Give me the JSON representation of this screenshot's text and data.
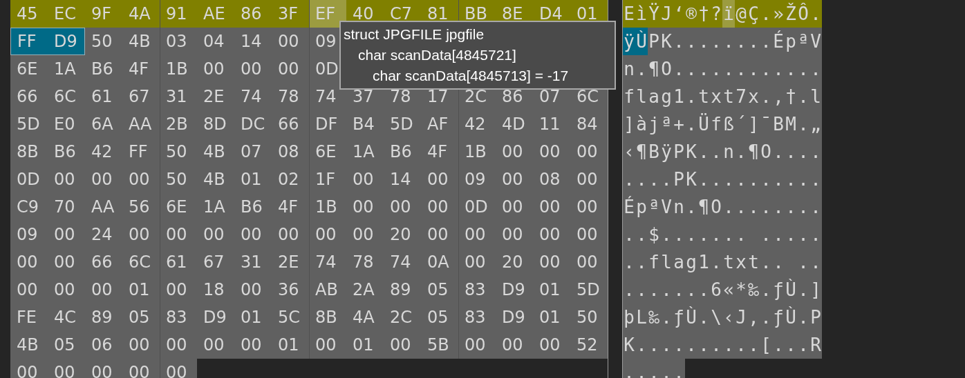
{
  "hex_rows": [
    {
      "highlighted": true,
      "bytes": [
        {
          "hex": "45",
          "selected": false,
          "hovered": false
        },
        {
          "hex": "EC",
          "selected": false,
          "hovered": false
        },
        {
          "hex": "9F",
          "selected": false,
          "hovered": false
        },
        {
          "hex": "4A",
          "selected": false,
          "hovered": false
        },
        {
          "hex": "91",
          "selected": false,
          "hovered": false
        },
        {
          "hex": "AE",
          "selected": false,
          "hovered": false
        },
        {
          "hex": "86",
          "selected": false,
          "hovered": false
        },
        {
          "hex": "3F",
          "selected": false,
          "hovered": false
        },
        {
          "hex": "EF",
          "selected": false,
          "hovered": true
        },
        {
          "hex": "40",
          "selected": false,
          "hovered": false
        },
        {
          "hex": "C7",
          "selected": false,
          "hovered": false
        },
        {
          "hex": "81",
          "selected": false,
          "hovered": false
        },
        {
          "hex": "BB",
          "selected": false,
          "hovered": false
        },
        {
          "hex": "8E",
          "selected": false,
          "hovered": false
        },
        {
          "hex": "D4",
          "selected": false,
          "hovered": false
        },
        {
          "hex": "01",
          "selected": false,
          "hovered": false
        }
      ],
      "text": "EìŸJ‘®†?ï@Ç.»ŽÔ."
    },
    {
      "highlighted": false,
      "bytes": [
        {
          "hex": "FF",
          "selected": true,
          "hovered": false
        },
        {
          "hex": "D9",
          "selected": true,
          "hovered": false
        },
        {
          "hex": "50",
          "selected": false,
          "hovered": false
        },
        {
          "hex": "4B",
          "selected": false,
          "hovered": false
        },
        {
          "hex": "03",
          "selected": false,
          "hovered": false
        },
        {
          "hex": "04",
          "selected": false,
          "hovered": false
        },
        {
          "hex": "14",
          "selected": false,
          "hovered": false
        },
        {
          "hex": "00",
          "selected": false,
          "hovered": false
        },
        {
          "hex": "09",
          "selected": false,
          "hovered": false
        }
      ],
      "text": "ÿÙPK........ÉpªV"
    },
    {
      "highlighted": false,
      "bytes": [
        {
          "hex": "6E",
          "selected": false,
          "hovered": false
        },
        {
          "hex": "1A",
          "selected": false,
          "hovered": false
        },
        {
          "hex": "B6",
          "selected": false,
          "hovered": false
        },
        {
          "hex": "4F",
          "selected": false,
          "hovered": false
        },
        {
          "hex": "1B",
          "selected": false,
          "hovered": false
        },
        {
          "hex": "00",
          "selected": false,
          "hovered": false
        },
        {
          "hex": "00",
          "selected": false,
          "hovered": false
        },
        {
          "hex": "00",
          "selected": false,
          "hovered": false
        },
        {
          "hex": "0D",
          "selected": false,
          "hovered": false
        }
      ],
      "text": "n.¶O............"
    },
    {
      "highlighted": false,
      "bytes": [
        {
          "hex": "66",
          "selected": false,
          "hovered": false
        },
        {
          "hex": "6C",
          "selected": false,
          "hovered": false
        },
        {
          "hex": "61",
          "selected": false,
          "hovered": false
        },
        {
          "hex": "67",
          "selected": false,
          "hovered": false
        },
        {
          "hex": "31",
          "selected": false,
          "hovered": false
        },
        {
          "hex": "2E",
          "selected": false,
          "hovered": false
        },
        {
          "hex": "74",
          "selected": false,
          "hovered": false
        },
        {
          "hex": "78",
          "selected": false,
          "hovered": false
        },
        {
          "hex": "74",
          "selected": false,
          "hovered": false
        },
        {
          "hex": "37",
          "selected": false,
          "hovered": false
        },
        {
          "hex": "78",
          "selected": false,
          "hovered": false
        },
        {
          "hex": "17",
          "selected": false,
          "hovered": false
        },
        {
          "hex": "2C",
          "selected": false,
          "hovered": false
        },
        {
          "hex": "86",
          "selected": false,
          "hovered": false
        },
        {
          "hex": "07",
          "selected": false,
          "hovered": false
        },
        {
          "hex": "6C",
          "selected": false,
          "hovered": false
        }
      ],
      "text": "flag1.txt7x.,†.l"
    },
    {
      "highlighted": false,
      "bytes": [
        {
          "hex": "5D",
          "selected": false,
          "hovered": false
        },
        {
          "hex": "E0",
          "selected": false,
          "hovered": false
        },
        {
          "hex": "6A",
          "selected": false,
          "hovered": false
        },
        {
          "hex": "AA",
          "selected": false,
          "hovered": false
        },
        {
          "hex": "2B",
          "selected": false,
          "hovered": false
        },
        {
          "hex": "8D",
          "selected": false,
          "hovered": false
        },
        {
          "hex": "DC",
          "selected": false,
          "hovered": false
        },
        {
          "hex": "66",
          "selected": false,
          "hovered": false
        },
        {
          "hex": "DF",
          "selected": false,
          "hovered": false
        },
        {
          "hex": "B4",
          "selected": false,
          "hovered": false
        },
        {
          "hex": "5D",
          "selected": false,
          "hovered": false
        },
        {
          "hex": "AF",
          "selected": false,
          "hovered": false
        },
        {
          "hex": "42",
          "selected": false,
          "hovered": false
        },
        {
          "hex": "4D",
          "selected": false,
          "hovered": false
        },
        {
          "hex": "11",
          "selected": false,
          "hovered": false
        },
        {
          "hex": "84",
          "selected": false,
          "hovered": false
        }
      ],
      "text": "]àjª+.Üfß´]¯BM.„"
    },
    {
      "highlighted": false,
      "bytes": [
        {
          "hex": "8B",
          "selected": false,
          "hovered": false
        },
        {
          "hex": "B6",
          "selected": false,
          "hovered": false
        },
        {
          "hex": "42",
          "selected": false,
          "hovered": false
        },
        {
          "hex": "FF",
          "selected": false,
          "hovered": false
        },
        {
          "hex": "50",
          "selected": false,
          "hovered": false
        },
        {
          "hex": "4B",
          "selected": false,
          "hovered": false
        },
        {
          "hex": "07",
          "selected": false,
          "hovered": false
        },
        {
          "hex": "08",
          "selected": false,
          "hovered": false
        },
        {
          "hex": "6E",
          "selected": false,
          "hovered": false
        },
        {
          "hex": "1A",
          "selected": false,
          "hovered": false
        },
        {
          "hex": "B6",
          "selected": false,
          "hovered": false
        },
        {
          "hex": "4F",
          "selected": false,
          "hovered": false
        },
        {
          "hex": "1B",
          "selected": false,
          "hovered": false
        },
        {
          "hex": "00",
          "selected": false,
          "hovered": false
        },
        {
          "hex": "00",
          "selected": false,
          "hovered": false
        },
        {
          "hex": "00",
          "selected": false,
          "hovered": false
        }
      ],
      "text": "‹¶BÿPK..n.¶O...."
    },
    {
      "highlighted": false,
      "bytes": [
        {
          "hex": "0D",
          "selected": false,
          "hovered": false
        },
        {
          "hex": "00",
          "selected": false,
          "hovered": false
        },
        {
          "hex": "00",
          "selected": false,
          "hovered": false
        },
        {
          "hex": "00",
          "selected": false,
          "hovered": false
        },
        {
          "hex": "50",
          "selected": false,
          "hovered": false
        },
        {
          "hex": "4B",
          "selected": false,
          "hovered": false
        },
        {
          "hex": "01",
          "selected": false,
          "hovered": false
        },
        {
          "hex": "02",
          "selected": false,
          "hovered": false
        },
        {
          "hex": "1F",
          "selected": false,
          "hovered": false
        },
        {
          "hex": "00",
          "selected": false,
          "hovered": false
        },
        {
          "hex": "14",
          "selected": false,
          "hovered": false
        },
        {
          "hex": "00",
          "selected": false,
          "hovered": false
        },
        {
          "hex": "09",
          "selected": false,
          "hovered": false
        },
        {
          "hex": "00",
          "selected": false,
          "hovered": false
        },
        {
          "hex": "08",
          "selected": false,
          "hovered": false
        },
        {
          "hex": "00",
          "selected": false,
          "hovered": false
        }
      ],
      "text": "....PK.........."
    },
    {
      "highlighted": false,
      "bytes": [
        {
          "hex": "C9",
          "selected": false,
          "hovered": false
        },
        {
          "hex": "70",
          "selected": false,
          "hovered": false
        },
        {
          "hex": "AA",
          "selected": false,
          "hovered": false
        },
        {
          "hex": "56",
          "selected": false,
          "hovered": false
        },
        {
          "hex": "6E",
          "selected": false,
          "hovered": false
        },
        {
          "hex": "1A",
          "selected": false,
          "hovered": false
        },
        {
          "hex": "B6",
          "selected": false,
          "hovered": false
        },
        {
          "hex": "4F",
          "selected": false,
          "hovered": false
        },
        {
          "hex": "1B",
          "selected": false,
          "hovered": false
        },
        {
          "hex": "00",
          "selected": false,
          "hovered": false
        },
        {
          "hex": "00",
          "selected": false,
          "hovered": false
        },
        {
          "hex": "00",
          "selected": false,
          "hovered": false
        },
        {
          "hex": "0D",
          "selected": false,
          "hovered": false
        },
        {
          "hex": "00",
          "selected": false,
          "hovered": false
        },
        {
          "hex": "00",
          "selected": false,
          "hovered": false
        },
        {
          "hex": "00",
          "selected": false,
          "hovered": false
        }
      ],
      "text": "ÉpªVn.¶O........"
    },
    {
      "highlighted": false,
      "bytes": [
        {
          "hex": "09",
          "selected": false,
          "hovered": false
        },
        {
          "hex": "00",
          "selected": false,
          "hovered": false
        },
        {
          "hex": "24",
          "selected": false,
          "hovered": false
        },
        {
          "hex": "00",
          "selected": false,
          "hovered": false
        },
        {
          "hex": "00",
          "selected": false,
          "hovered": false
        },
        {
          "hex": "00",
          "selected": false,
          "hovered": false
        },
        {
          "hex": "00",
          "selected": false,
          "hovered": false
        },
        {
          "hex": "00",
          "selected": false,
          "hovered": false
        },
        {
          "hex": "00",
          "selected": false,
          "hovered": false
        },
        {
          "hex": "00",
          "selected": false,
          "hovered": false
        },
        {
          "hex": "20",
          "selected": false,
          "hovered": false
        },
        {
          "hex": "00",
          "selected": false,
          "hovered": false
        },
        {
          "hex": "00",
          "selected": false,
          "hovered": false
        },
        {
          "hex": "00",
          "selected": false,
          "hovered": false
        },
        {
          "hex": "00",
          "selected": false,
          "hovered": false
        },
        {
          "hex": "00",
          "selected": false,
          "hovered": false
        }
      ],
      "text": "..$....... ....."
    },
    {
      "highlighted": false,
      "bytes": [
        {
          "hex": "00",
          "selected": false,
          "hovered": false
        },
        {
          "hex": "00",
          "selected": false,
          "hovered": false
        },
        {
          "hex": "66",
          "selected": false,
          "hovered": false
        },
        {
          "hex": "6C",
          "selected": false,
          "hovered": false
        },
        {
          "hex": "61",
          "selected": false,
          "hovered": false
        },
        {
          "hex": "67",
          "selected": false,
          "hovered": false
        },
        {
          "hex": "31",
          "selected": false,
          "hovered": false
        },
        {
          "hex": "2E",
          "selected": false,
          "hovered": false
        },
        {
          "hex": "74",
          "selected": false,
          "hovered": false
        },
        {
          "hex": "78",
          "selected": false,
          "hovered": false
        },
        {
          "hex": "74",
          "selected": false,
          "hovered": false
        },
        {
          "hex": "0A",
          "selected": false,
          "hovered": false
        },
        {
          "hex": "00",
          "selected": false,
          "hovered": false
        },
        {
          "hex": "20",
          "selected": false,
          "hovered": false
        },
        {
          "hex": "00",
          "selected": false,
          "hovered": false
        },
        {
          "hex": "00",
          "selected": false,
          "hovered": false
        }
      ],
      "text": "..flag1.txt.. .."
    },
    {
      "highlighted": false,
      "bytes": [
        {
          "hex": "00",
          "selected": false,
          "hovered": false
        },
        {
          "hex": "00",
          "selected": false,
          "hovered": false
        },
        {
          "hex": "00",
          "selected": false,
          "hovered": false
        },
        {
          "hex": "01",
          "selected": false,
          "hovered": false
        },
        {
          "hex": "00",
          "selected": false,
          "hovered": false
        },
        {
          "hex": "18",
          "selected": false,
          "hovered": false
        },
        {
          "hex": "00",
          "selected": false,
          "hovered": false
        },
        {
          "hex": "36",
          "selected": false,
          "hovered": false
        },
        {
          "hex": "AB",
          "selected": false,
          "hovered": false
        },
        {
          "hex": "2A",
          "selected": false,
          "hovered": false
        },
        {
          "hex": "89",
          "selected": false,
          "hovered": false
        },
        {
          "hex": "05",
          "selected": false,
          "hovered": false
        },
        {
          "hex": "83",
          "selected": false,
          "hovered": false
        },
        {
          "hex": "D9",
          "selected": false,
          "hovered": false
        },
        {
          "hex": "01",
          "selected": false,
          "hovered": false
        },
        {
          "hex": "5D",
          "selected": false,
          "hovered": false
        }
      ],
      "text": ".......6«*‰.ƒÙ.]"
    },
    {
      "highlighted": false,
      "bytes": [
        {
          "hex": "FE",
          "selected": false,
          "hovered": false
        },
        {
          "hex": "4C",
          "selected": false,
          "hovered": false
        },
        {
          "hex": "89",
          "selected": false,
          "hovered": false
        },
        {
          "hex": "05",
          "selected": false,
          "hovered": false
        },
        {
          "hex": "83",
          "selected": false,
          "hovered": false
        },
        {
          "hex": "D9",
          "selected": false,
          "hovered": false
        },
        {
          "hex": "01",
          "selected": false,
          "hovered": false
        },
        {
          "hex": "5C",
          "selected": false,
          "hovered": false
        },
        {
          "hex": "8B",
          "selected": false,
          "hovered": false
        },
        {
          "hex": "4A",
          "selected": false,
          "hovered": false
        },
        {
          "hex": "2C",
          "selected": false,
          "hovered": false
        },
        {
          "hex": "05",
          "selected": false,
          "hovered": false
        },
        {
          "hex": "83",
          "selected": false,
          "hovered": false
        },
        {
          "hex": "D9",
          "selected": false,
          "hovered": false
        },
        {
          "hex": "01",
          "selected": false,
          "hovered": false
        },
        {
          "hex": "50",
          "selected": false,
          "hovered": false
        }
      ],
      "text": "þL‰.ƒÙ.\\‹J,.ƒÙ.P"
    },
    {
      "highlighted": false,
      "bytes": [
        {
          "hex": "4B",
          "selected": false,
          "hovered": false
        },
        {
          "hex": "05",
          "selected": false,
          "hovered": false
        },
        {
          "hex": "06",
          "selected": false,
          "hovered": false
        },
        {
          "hex": "00",
          "selected": false,
          "hovered": false
        },
        {
          "hex": "00",
          "selected": false,
          "hovered": false
        },
        {
          "hex": "00",
          "selected": false,
          "hovered": false
        },
        {
          "hex": "00",
          "selected": false,
          "hovered": false
        },
        {
          "hex": "01",
          "selected": false,
          "hovered": false
        },
        {
          "hex": "00",
          "selected": false,
          "hovered": false
        },
        {
          "hex": "01",
          "selected": false,
          "hovered": false
        },
        {
          "hex": "00",
          "selected": false,
          "hovered": false
        },
        {
          "hex": "5B",
          "selected": false,
          "hovered": false
        },
        {
          "hex": "00",
          "selected": false,
          "hovered": false
        },
        {
          "hex": "00",
          "selected": false,
          "hovered": false
        },
        {
          "hex": "00",
          "selected": false,
          "hovered": false
        },
        {
          "hex": "52",
          "selected": false,
          "hovered": false
        }
      ],
      "text": "K..........[...R"
    },
    {
      "highlighted": false,
      "bytes": [
        {
          "hex": "00",
          "selected": false,
          "hovered": false
        },
        {
          "hex": "00",
          "selected": false,
          "hovered": false
        },
        {
          "hex": "00",
          "selected": false,
          "hovered": false
        },
        {
          "hex": "00",
          "selected": false,
          "hovered": false
        },
        {
          "hex": "00",
          "selected": false,
          "hovered": false
        }
      ],
      "text": "....."
    }
  ],
  "tooltip": {
    "lines": [
      {
        "text": "struct JPGFILE jpgfile",
        "children": [
          {
            "text": "char scanData[4845721]",
            "children": [
              {
                "text": "char scanData[4845713] = -17"
              }
            ]
          }
        ]
      }
    ]
  }
}
